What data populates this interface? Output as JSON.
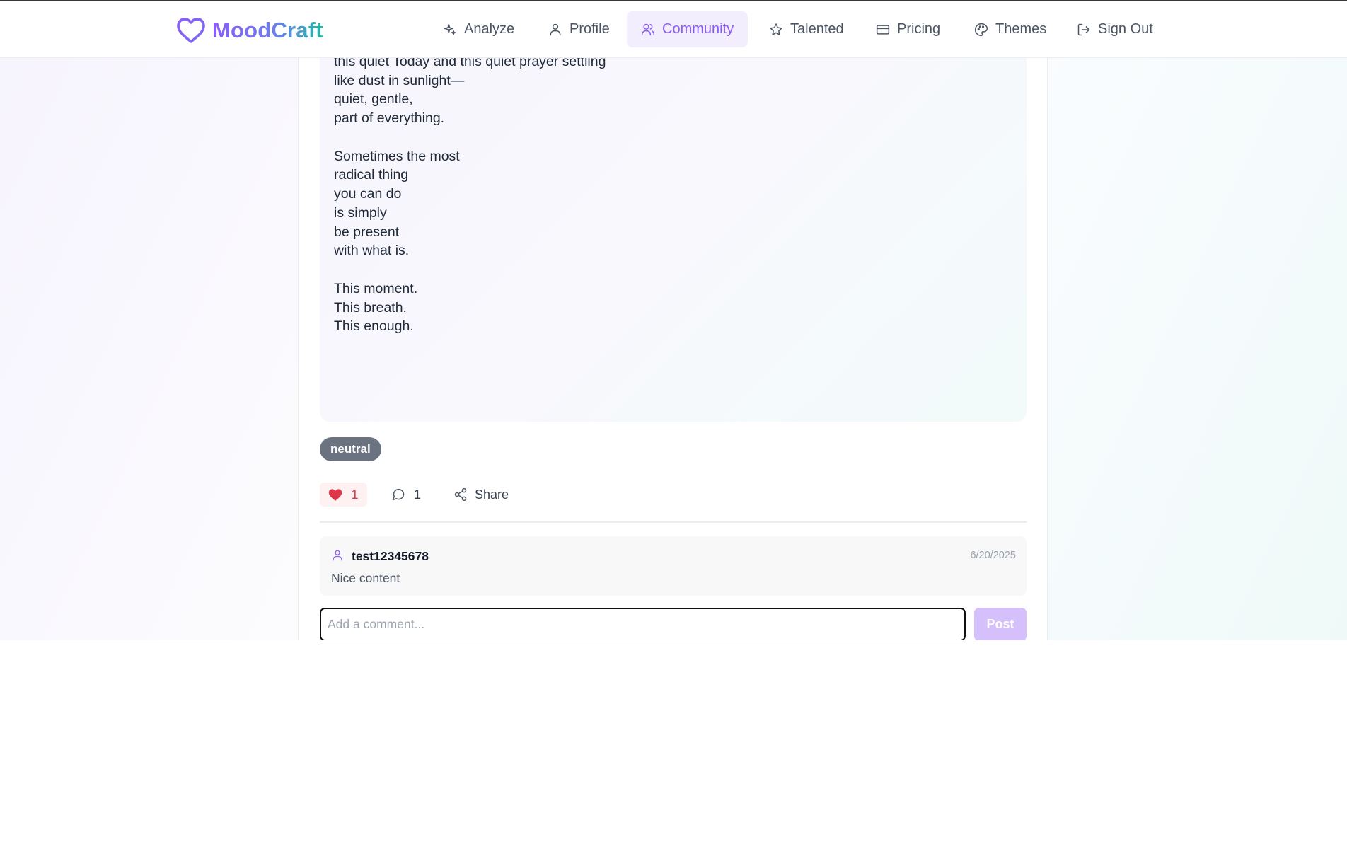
{
  "app": {
    "name": "MoodCraft"
  },
  "nav": {
    "items": [
      {
        "label": "Analyze",
        "icon": "sparkles-icon"
      },
      {
        "label": "Profile",
        "icon": "user-icon"
      },
      {
        "label": "Community",
        "icon": "users-icon",
        "active": true
      },
      {
        "label": "Talented",
        "icon": "star-icon"
      },
      {
        "label": "Pricing",
        "icon": "credit-card-icon"
      },
      {
        "label": "Themes",
        "icon": "palette-icon"
      },
      {
        "label": "Sign Out",
        "icon": "log-out-icon"
      }
    ]
  },
  "post": {
    "poem_lines": [
      "this quiet Today and this quiet prayer settling",
      "like dust in sunlight—",
      "quiet, gentle,",
      "part of everything.",
      "Sometimes the most",
      "radical thing",
      "you can do",
      "is simply",
      "be present",
      "with what is.",
      "This moment.",
      "This breath.",
      "This enough."
    ],
    "tag": "neutral",
    "likes": "1",
    "comments_count": "1",
    "share_label": "Share"
  },
  "comments": [
    {
      "user": "test12345678",
      "date": "6/20/2025",
      "text": "Nice content"
    }
  ],
  "comment_form": {
    "placeholder": "Add a comment...",
    "post_label": "Post"
  },
  "colors": {
    "accent": "#8b5cf6",
    "like": "#e0364a",
    "tag_bg": "#6b7280"
  }
}
